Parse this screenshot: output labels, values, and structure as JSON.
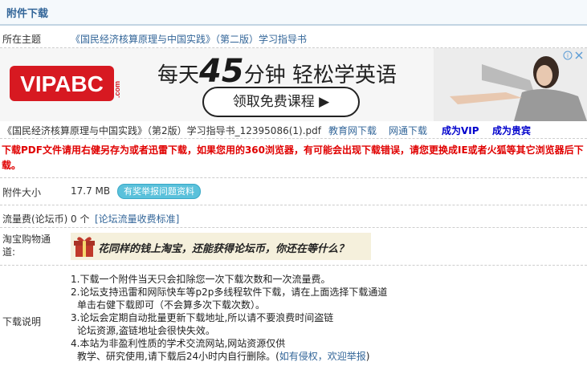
{
  "header": {
    "title": "附件下载"
  },
  "topic": {
    "label": "所在主题",
    "value": "《国民经济核算原理与中国实践》（第二版）学习指导书"
  },
  "ad": {
    "brand": "VIPABC",
    "brand_suffix": ".com",
    "line_prefix": "每天",
    "line_number": "45",
    "line_suffix": "分钟 轻松学英语",
    "button_label": "领取免费课程",
    "close_icons": "i ✕"
  },
  "file": {
    "name": "《国民经济核算原理与中国实践》（第2版）学习指导书_12395086(1).pdf",
    "links": [
      "教育网下载",
      "网通下载"
    ],
    "vip_links": [
      "成为VIP",
      "成为贵宾"
    ]
  },
  "warning": "下载PDF文件请用右健另存为或者迅雷下载，如果您用的360浏览器，有可能会出现下载错误，请您更换成IE或者火狐等其它浏览器后下载。",
  "size": {
    "label": "附件大小",
    "value": "17.7 MB",
    "report_button": "有奖举报问题资料"
  },
  "fee": {
    "label": "流量费(论坛币)",
    "value": "0 个",
    "link": "[论坛流量收费标准]"
  },
  "taobao": {
    "label_line1": "淘宝购物通",
    "label_line2": "道:",
    "banner_text": "花同样的钱上淘宝，还能获得论坛币，你还在等什么？"
  },
  "notes": {
    "label": "下载说明",
    "lines": [
      "1.下载一个附件当天只会扣除您一次下载次数和一次流量费。",
      "2.论坛支持迅雷和网际快车等p2p多线程软件下载，请在上面选择下载通道",
      "  单击右健下载即可（不会算多次下载次数）。",
      "3.论坛会定期自动批量更新下载地址,所以请不要浪费时间盗链",
      "  论坛资源,盗链地址会很快失效。",
      "4.本站为非盈利性质的学术交流网站,网站资源仅供",
      "  教学、研究使用,请下载后24小时内自行删除。("
    ],
    "report_link": "如有侵权，欢迎举报",
    "close_paren": ")"
  },
  "colors": {
    "link": "#336699",
    "warning": "#e00000",
    "vip": "#0000cc",
    "brand_red": "#d71921"
  }
}
